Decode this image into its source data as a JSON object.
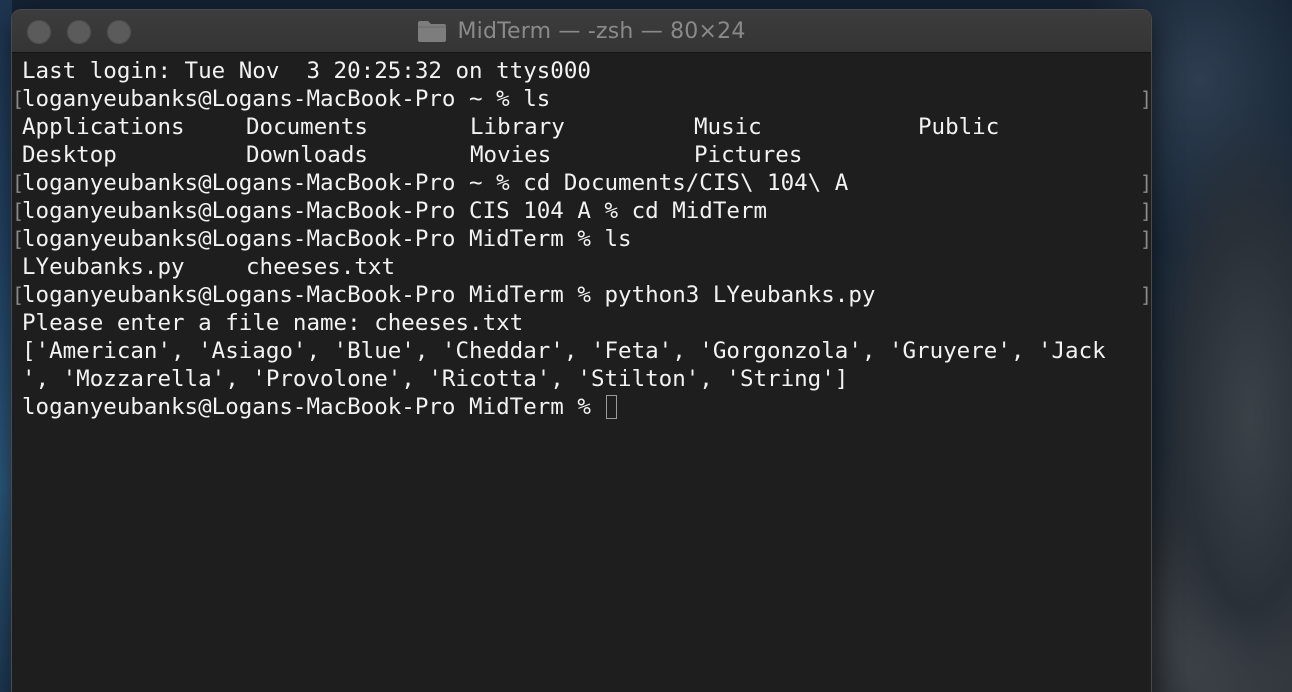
{
  "window": {
    "title": "MidTerm — -zsh — 80×24"
  },
  "terminal": {
    "lines": [
      {
        "text": "Last login: Tue Nov  3 20:25:32 on ttys000",
        "marked": false
      },
      {
        "text": "loganyeubanks@Logans-MacBook-Pro ~ % ls",
        "marked": true
      },
      {
        "cols": [
          "Applications",
          "Documents",
          "Library",
          "Music",
          "Public"
        ]
      },
      {
        "cols": [
          "Desktop",
          "Downloads",
          "Movies",
          "Pictures"
        ]
      },
      {
        "text": "loganyeubanks@Logans-MacBook-Pro ~ % cd Documents/CIS\\ 104\\ A",
        "marked": true
      },
      {
        "text": "loganyeubanks@Logans-MacBook-Pro CIS 104 A % cd MidTerm",
        "marked": true
      },
      {
        "text": "loganyeubanks@Logans-MacBook-Pro MidTerm % ls",
        "marked": true
      },
      {
        "cols": [
          "LYeubanks.py",
          "cheeses.txt"
        ]
      },
      {
        "text": "loganyeubanks@Logans-MacBook-Pro MidTerm % python3 LYeubanks.py",
        "marked": true
      },
      {
        "text": "Please enter a file name: cheeses.txt",
        "marked": false
      },
      {
        "text": "['American', 'Asiago', 'Blue', 'Cheddar', 'Feta', 'Gorgonzola', 'Gruyere', 'Jack",
        "marked": false
      },
      {
        "text": "', 'Mozzarella', 'Provolone', 'Ricotta', 'Stilton', 'String']",
        "marked": false
      }
    ],
    "prompt": "loganyeubanks@Logans-MacBook-Pro MidTerm % ",
    "mark_open": "[",
    "mark_close": "]"
  },
  "icons": {
    "title_folder": "folder-icon",
    "cursor": "block-cursor"
  },
  "colors": {
    "terminal_bg": "#1e1e1e",
    "terminal_text": "#f2f2f2",
    "titlebar_text": "#8a8a8a"
  }
}
